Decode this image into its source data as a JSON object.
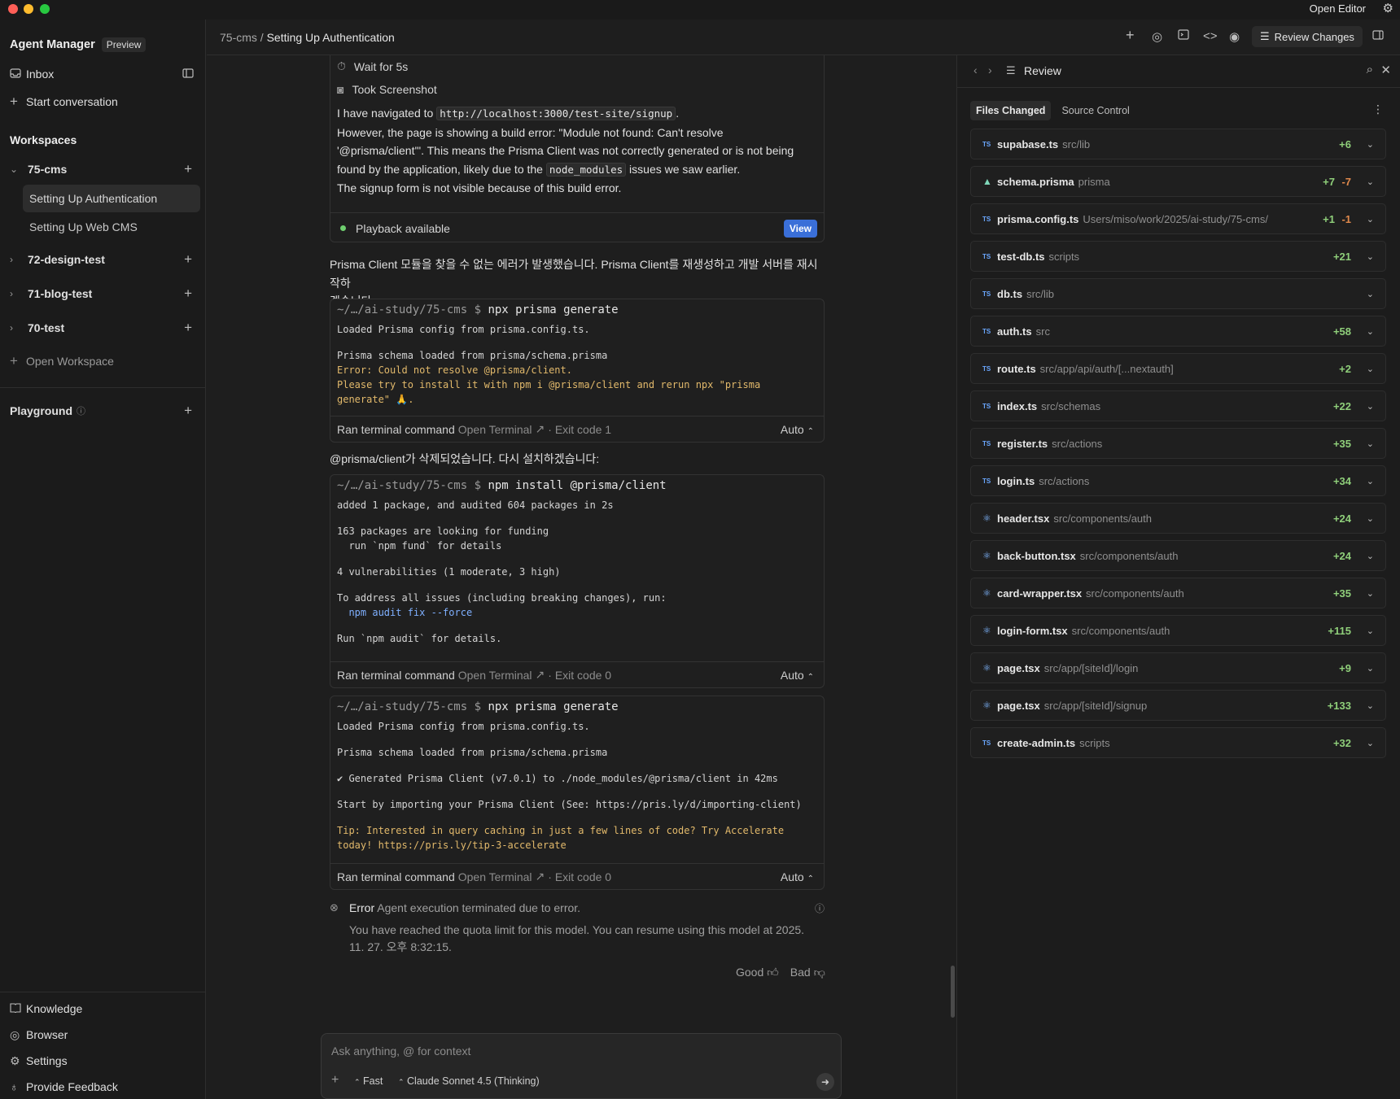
{
  "titlebar": {
    "open_editor": "Open Editor"
  },
  "sidebar": {
    "app_title": "Agent Manager",
    "preview_badge": "Preview",
    "inbox": "Inbox",
    "start_conversation": "Start conversation",
    "workspaces_heading": "Workspaces",
    "workspaces": [
      {
        "name": "75-cms",
        "children": [
          "Setting Up Authentication",
          "Setting Up Web CMS"
        ]
      },
      {
        "name": "72-design-test"
      },
      {
        "name": "71-blog-test"
      },
      {
        "name": "70-test"
      }
    ],
    "open_workspace": "Open Workspace",
    "playground": "Playground",
    "bottom": [
      "Knowledge",
      "Browser",
      "Settings",
      "Provide Feedback"
    ]
  },
  "header": {
    "breadcrumb_project": "75-cms",
    "breadcrumb_sep": "/",
    "breadcrumb_title": "Setting Up Authentication",
    "review_changes": "Review Changes"
  },
  "chat": {
    "wait": "Wait for 5s",
    "took_screenshot": "Took Screenshot",
    "nav_prefix": "I have navigated to",
    "nav_url": "http://localhost:3000/test-site/signup",
    "nav_line2": "However, the page is showing a build error: \"Module not found: Can't resolve",
    "nav_line3": "'@prisma/client'\". This means the Prisma Client was not correctly generated or is not being",
    "nav_line4a": "found by the application, likely due to the",
    "nav_code": "node_modules",
    "nav_line4b": "issues we saw earlier.",
    "nav_line5": "The signup form is not visible because of this build error.",
    "playback": "Playback available",
    "view": "View",
    "korean1_a": "Prisma Client 모듈을 찾을 수 없는 에러가 발생했습니다. Prisma Client를 재생성하고 개발 서버를 재시작하",
    "korean1_b": "겠습니다:",
    "korean2": "@prisma/client가 삭제되었습니다. 다시 설치하겠습니다:",
    "prompt_path": "~/…/ai-study/75-cms $",
    "term1": {
      "cmd": "npx prisma generate",
      "lines": [
        "Loaded Prisma config from prisma.config.ts.",
        "",
        "Prisma schema loaded from prisma/schema.prisma",
        "Error: Could not resolve @prisma/client.",
        "Please try to install it with npm i @prisma/client and rerun npx \"prisma",
        "generate\" 🙏."
      ],
      "footer": "Ran terminal command",
      "open_terminal": "Open Terminal",
      "exit": "· Exit code 1",
      "auto": "Auto"
    },
    "term2": {
      "cmd": "npm install @prisma/client",
      "lines": [
        "added 1 package, and audited 604 packages in 2s",
        "",
        "163 packages are looking for funding",
        "  run `npm fund` for details",
        "",
        "4 vulnerabilities (1 moderate, 3 high)",
        "",
        "To address all issues (including breaking changes), run:",
        "  npm audit fix --force",
        "",
        "Run `npm audit` for details."
      ],
      "footer": "Ran terminal command",
      "open_terminal": "Open Terminal",
      "exit": "· Exit code 0",
      "auto": "Auto"
    },
    "term3": {
      "cmd": "npx prisma generate",
      "lines": [
        "Loaded Prisma config from prisma.config.ts.",
        "",
        "Prisma schema loaded from prisma/schema.prisma",
        "",
        "✔ Generated Prisma Client (v7.0.1) to ./node_modules/@prisma/client in 42ms",
        "",
        "Start by importing your Prisma Client (See: https://pris.ly/d/importing-client)",
        "",
        "Tip: Interested in query caching in just a few lines of code? Try Accelerate",
        "today! https://pris.ly/tip-3-accelerate"
      ],
      "footer": "Ran terminal command",
      "open_terminal": "Open Terminal",
      "exit": "· Exit code 0",
      "auto": "Auto"
    },
    "error_label": "Error",
    "error_msg": "Agent execution terminated due to error.",
    "error_detail_1": "You have reached the quota limit for this model. You can resume using this model at 2025.",
    "error_detail_2": "11. 27. 오후 8:32:15.",
    "good": "Good",
    "bad": "Bad",
    "input_placeholder": "Ask anything, @ for context",
    "mode": "Fast",
    "model": "Claude Sonnet 4.5 (Thinking)"
  },
  "review": {
    "title": "Review",
    "tab_files": "Files Changed",
    "tab_source": "Source Control",
    "files": [
      {
        "icon": "ts",
        "name": "supabase.ts",
        "path": "src/lib",
        "add": "+6",
        "del": ""
      },
      {
        "icon": "prisma",
        "name": "schema.prisma",
        "path": "prisma",
        "add": "+7",
        "del": "-7"
      },
      {
        "icon": "ts",
        "name": "prisma.config.ts",
        "path": "Users/miso/work/2025/ai-study/75-cms/",
        "add": "+1",
        "del": "-1"
      },
      {
        "icon": "ts",
        "name": "test-db.ts",
        "path": "scripts",
        "add": "+21",
        "del": ""
      },
      {
        "icon": "ts",
        "name": "db.ts",
        "path": "src/lib",
        "add": "",
        "del": ""
      },
      {
        "icon": "ts",
        "name": "auth.ts",
        "path": "src",
        "add": "+58",
        "del": ""
      },
      {
        "icon": "ts",
        "name": "route.ts",
        "path": "src/app/api/auth/[...nextauth]",
        "add": "+2",
        "del": ""
      },
      {
        "icon": "ts",
        "name": "index.ts",
        "path": "src/schemas",
        "add": "+22",
        "del": ""
      },
      {
        "icon": "ts",
        "name": "register.ts",
        "path": "src/actions",
        "add": "+35",
        "del": ""
      },
      {
        "icon": "ts",
        "name": "login.ts",
        "path": "src/actions",
        "add": "+34",
        "del": ""
      },
      {
        "icon": "react",
        "name": "header.tsx",
        "path": "src/components/auth",
        "add": "+24",
        "del": ""
      },
      {
        "icon": "react",
        "name": "back-button.tsx",
        "path": "src/components/auth",
        "add": "+24",
        "del": ""
      },
      {
        "icon": "react",
        "name": "card-wrapper.tsx",
        "path": "src/components/auth",
        "add": "+35",
        "del": ""
      },
      {
        "icon": "react",
        "name": "login-form.tsx",
        "path": "src/components/auth",
        "add": "+115",
        "del": ""
      },
      {
        "icon": "react",
        "name": "page.tsx",
        "path": "src/app/[siteId]/login",
        "add": "+9",
        "del": ""
      },
      {
        "icon": "react",
        "name": "page.tsx",
        "path": "src/app/[siteId]/signup",
        "add": "+133",
        "del": ""
      },
      {
        "icon": "ts",
        "name": "create-admin.ts",
        "path": "scripts",
        "add": "+32",
        "del": ""
      }
    ]
  }
}
